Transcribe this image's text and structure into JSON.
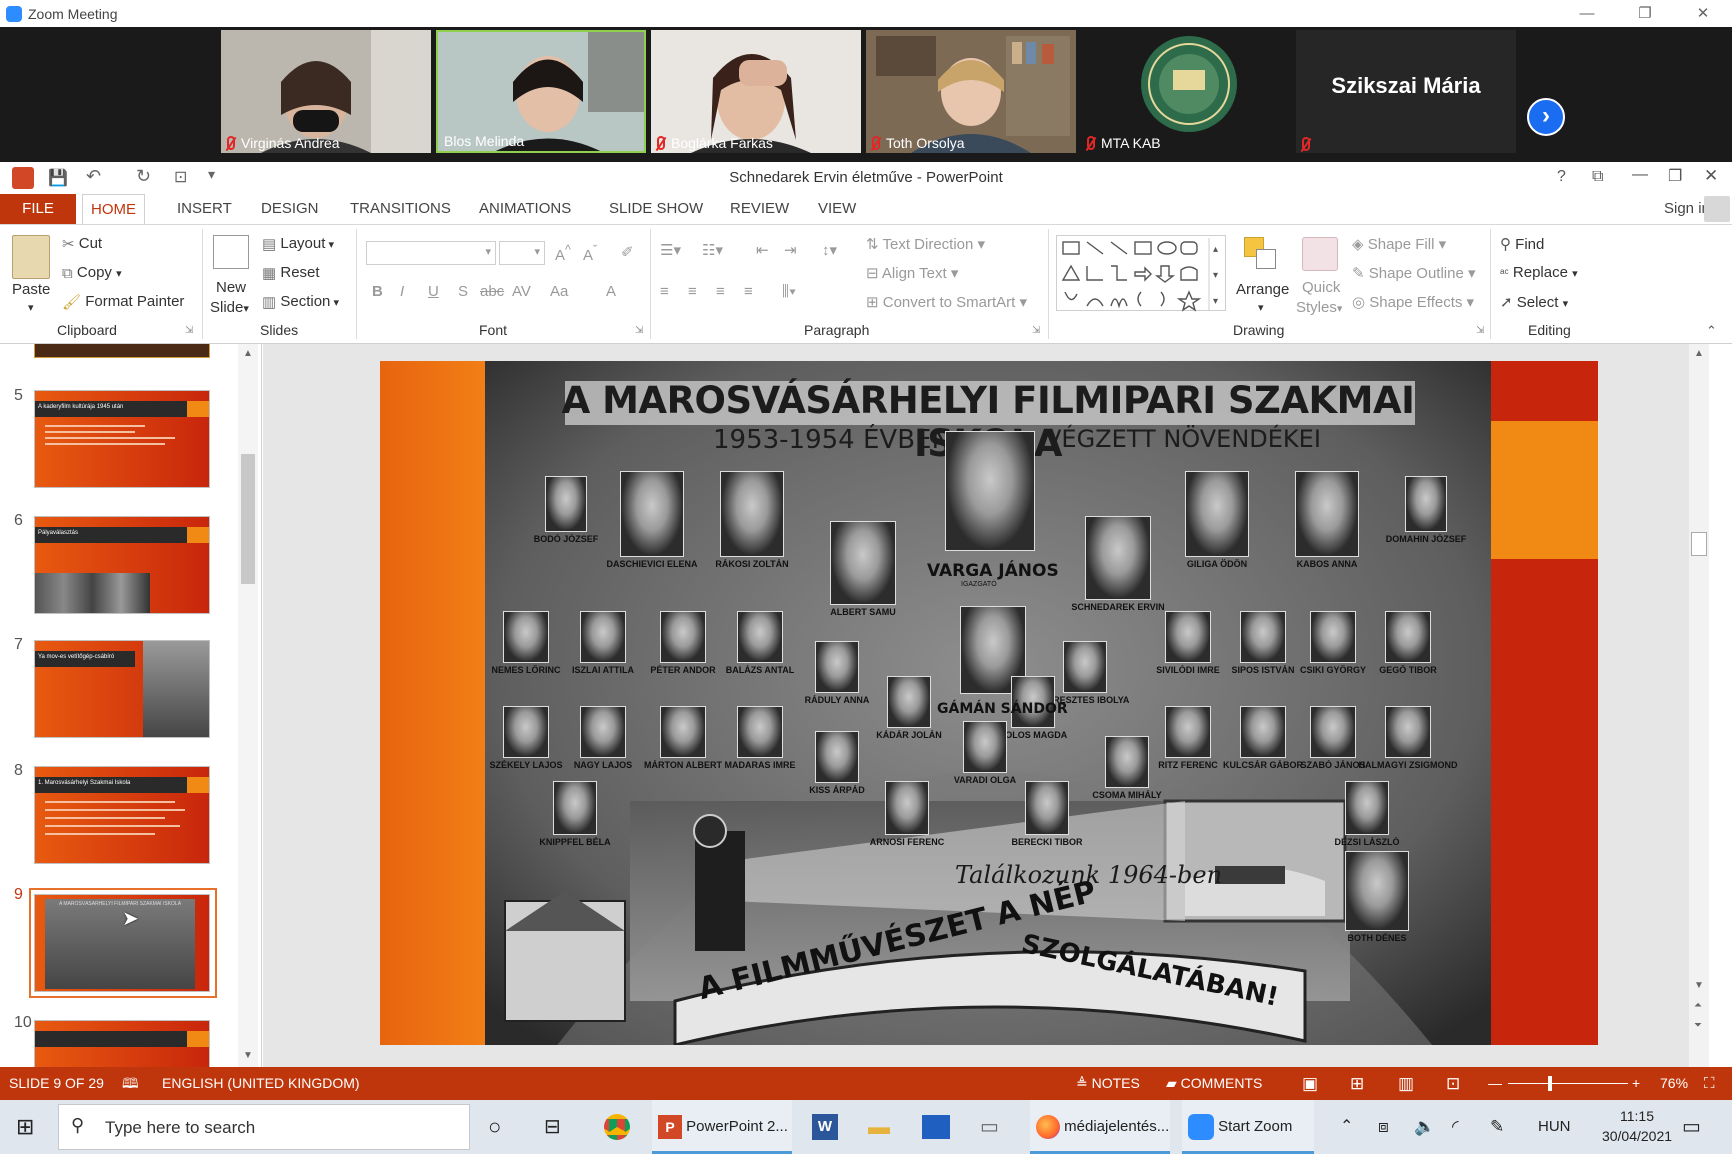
{
  "zoom": {
    "window_title": "Zoom Meeting",
    "participants": [
      {
        "name": "Virginás Andrea"
      },
      {
        "name": "Blos Melinda"
      },
      {
        "name": "Boglárka Farkas"
      },
      {
        "name": "Toth Orsolya"
      },
      {
        "name": "MTA KAB"
      }
    ],
    "featured_name": "Szikszai Mária"
  },
  "ppt": {
    "window_title": "Schnedarek Ervin életműve - PowerPoint",
    "sign_in": "Sign in",
    "tabs": [
      "FILE",
      "HOME",
      "INSERT",
      "DESIGN",
      "TRANSITIONS",
      "ANIMATIONS",
      "SLIDE SHOW",
      "REVIEW",
      "VIEW"
    ],
    "active_tab": "HOME",
    "ribbon": {
      "clipboard": {
        "label": "Clipboard",
        "paste": "Paste",
        "cut": "Cut",
        "copy": "Copy",
        "format_painter": "Format Painter"
      },
      "slides": {
        "label": "Slides",
        "new_slide_1": "New",
        "new_slide_2": "Slide",
        "layout": "Layout",
        "reset": "Reset",
        "section": "Section"
      },
      "font": {
        "label": "Font",
        "bold": "B",
        "italic": "I",
        "underline": "U",
        "strike": "S",
        "abc": "abc",
        "av": "AV",
        "aa": "Aa",
        "a": "A"
      },
      "paragraph": {
        "label": "Paragraph",
        "text_direction": "Text Direction",
        "align_text": "Align Text",
        "convert_smartart": "Convert to SmartArt"
      },
      "drawing": {
        "label": "Drawing",
        "arrange": "Arrange",
        "quick_styles_1": "Quick",
        "quick_styles_2": "Styles",
        "shape_fill": "Shape Fill",
        "shape_outline": "Shape Outline",
        "shape_effects": "Shape Effects"
      },
      "editing": {
        "label": "Editing",
        "find": "Find",
        "replace": "Replace",
        "select": "Select"
      }
    },
    "thumbnails": [
      {
        "num": "5",
        "title": "A kaderyfilm kultúrája 1945 után"
      },
      {
        "num": "6",
        "title": "Pályaválasztás"
      },
      {
        "num": "7",
        "title": "Ya mov-es vetítőgép-csábíró"
      },
      {
        "num": "8",
        "title": "1. Marosvásárhelyi Szakmai Iskola"
      },
      {
        "num": "9",
        "title": "A MAROSVÁSÁRHELYI FILMIPARI SZAKMAI ISKOLA"
      },
      {
        "num": "10",
        "title": ""
      }
    ],
    "slide": {
      "heading": "A MAROSVÁSÁRHELYI FILMIPARI SZAKMAI ISKOLA",
      "sub_left": "1953-1954 ÉVBEN",
      "sub_right": "VÉGZETT NÖVENDÉKEI",
      "center_name": "VARGA JÁNOS",
      "center_role": "IGAZGATÓ",
      "top_row": [
        "BODÓ JÓZSEF",
        "DASCHIEVICI ELENA",
        "RÁKOSI ZOLTÁN",
        "GILIGA ÖDÖN",
        "KABOS ANNA",
        "DOMAHIN JÓZSEF"
      ],
      "teachers": [
        "ALBERT SAMU",
        "SCHNEDAREK ERVIN"
      ],
      "row2": [
        "NEMES LŐRINC",
        "ISZLAI ATTILA",
        "PÉTER ANDOR",
        "BALÁZS ANTAL",
        "SIVILÓDI IMRE",
        "SIPOS ISTVÁN",
        "CSIKI GYÖRGY",
        "GEGŐ TIBOR"
      ],
      "center2": "GÁMÁN SÁNDOR",
      "row2b": [
        "RÁDULY ANNA",
        "KERESZTES IBOLYA",
        "KÁDÁR JOLÁN",
        "HOLOS MAGDA"
      ],
      "row3": [
        "SZÉKELY LAJOS",
        "NAGY LAJOS",
        "MÁRTON ALBERT",
        "MADARAS IMRE",
        "RITZ FERENC",
        "KULCSÁR GÁBOR",
        "SZABÓ JÁNOS",
        "HALMAGYI ZSIGMOND"
      ],
      "row3b": [
        "KISS ÁRPÁD",
        "VARADI OLGA",
        "CSOMA MIHÁLY"
      ],
      "row4": [
        "KNIPPFEL BÉLA",
        "ARNOSI FERENC",
        "BERECKI TIBOR",
        "DÉZSI LÁSZLÓ",
        "BOTH DÉNES"
      ],
      "slogan_script": "Találkozunk 1964-ben",
      "banner_1": "A FILMMŰVÉSZET A NÉP",
      "banner_2": "SZOLGÁLATÁBAN!"
    },
    "status": {
      "slide_of": "SLIDE 9 OF 29",
      "language": "ENGLISH (UNITED KINGDOM)",
      "notes": "NOTES",
      "comments": "COMMENTS",
      "zoom": "76%"
    }
  },
  "taskbar": {
    "search_placeholder": "Type here to search",
    "apps": [
      {
        "label": "PowerPoint 2..."
      },
      {
        "label": "médiajelentés..."
      },
      {
        "label": "Start Zoom"
      }
    ],
    "lang": "HUN",
    "time": "11:15",
    "date": "30/04/2021"
  },
  "colors": {
    "ppt_accent": "#c0360c",
    "zoom_blue": "#2d8cff",
    "slide_orange": "#f07a14"
  }
}
